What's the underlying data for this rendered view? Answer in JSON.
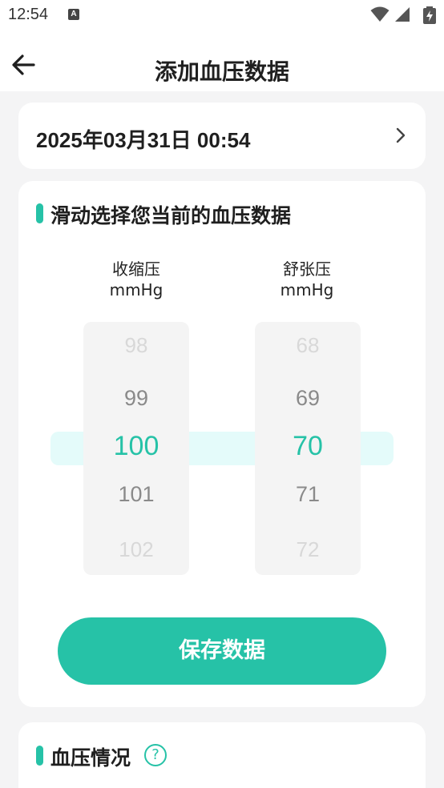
{
  "status_bar": {
    "time": "12:54",
    "icons": [
      "notification-a-icon",
      "wifi-icon",
      "signal-icon",
      "battery-charging-icon"
    ]
  },
  "header": {
    "title": "添加血压数据",
    "back_icon": "arrow-left-icon"
  },
  "date_row": {
    "value": "2025年03月31日 00:54",
    "chevron_icon": "chevron-right-icon"
  },
  "bp_input": {
    "section_title": "滑动选择您当前的血压数据",
    "accent_color": "#26c2a7",
    "systolic": {
      "label": "收缩压",
      "unit": "mmHg",
      "visible_values": [
        "98",
        "99",
        "100",
        "101",
        "102"
      ],
      "selected": "100"
    },
    "diastolic": {
      "label": "舒张压",
      "unit": "mmHg",
      "visible_values": [
        "68",
        "69",
        "70",
        "71",
        "72"
      ],
      "selected": "70"
    },
    "save_label": "保存数据"
  },
  "status_section": {
    "title": "血压情况",
    "help_icon": "question-circle-icon",
    "help_glyph": "?"
  }
}
